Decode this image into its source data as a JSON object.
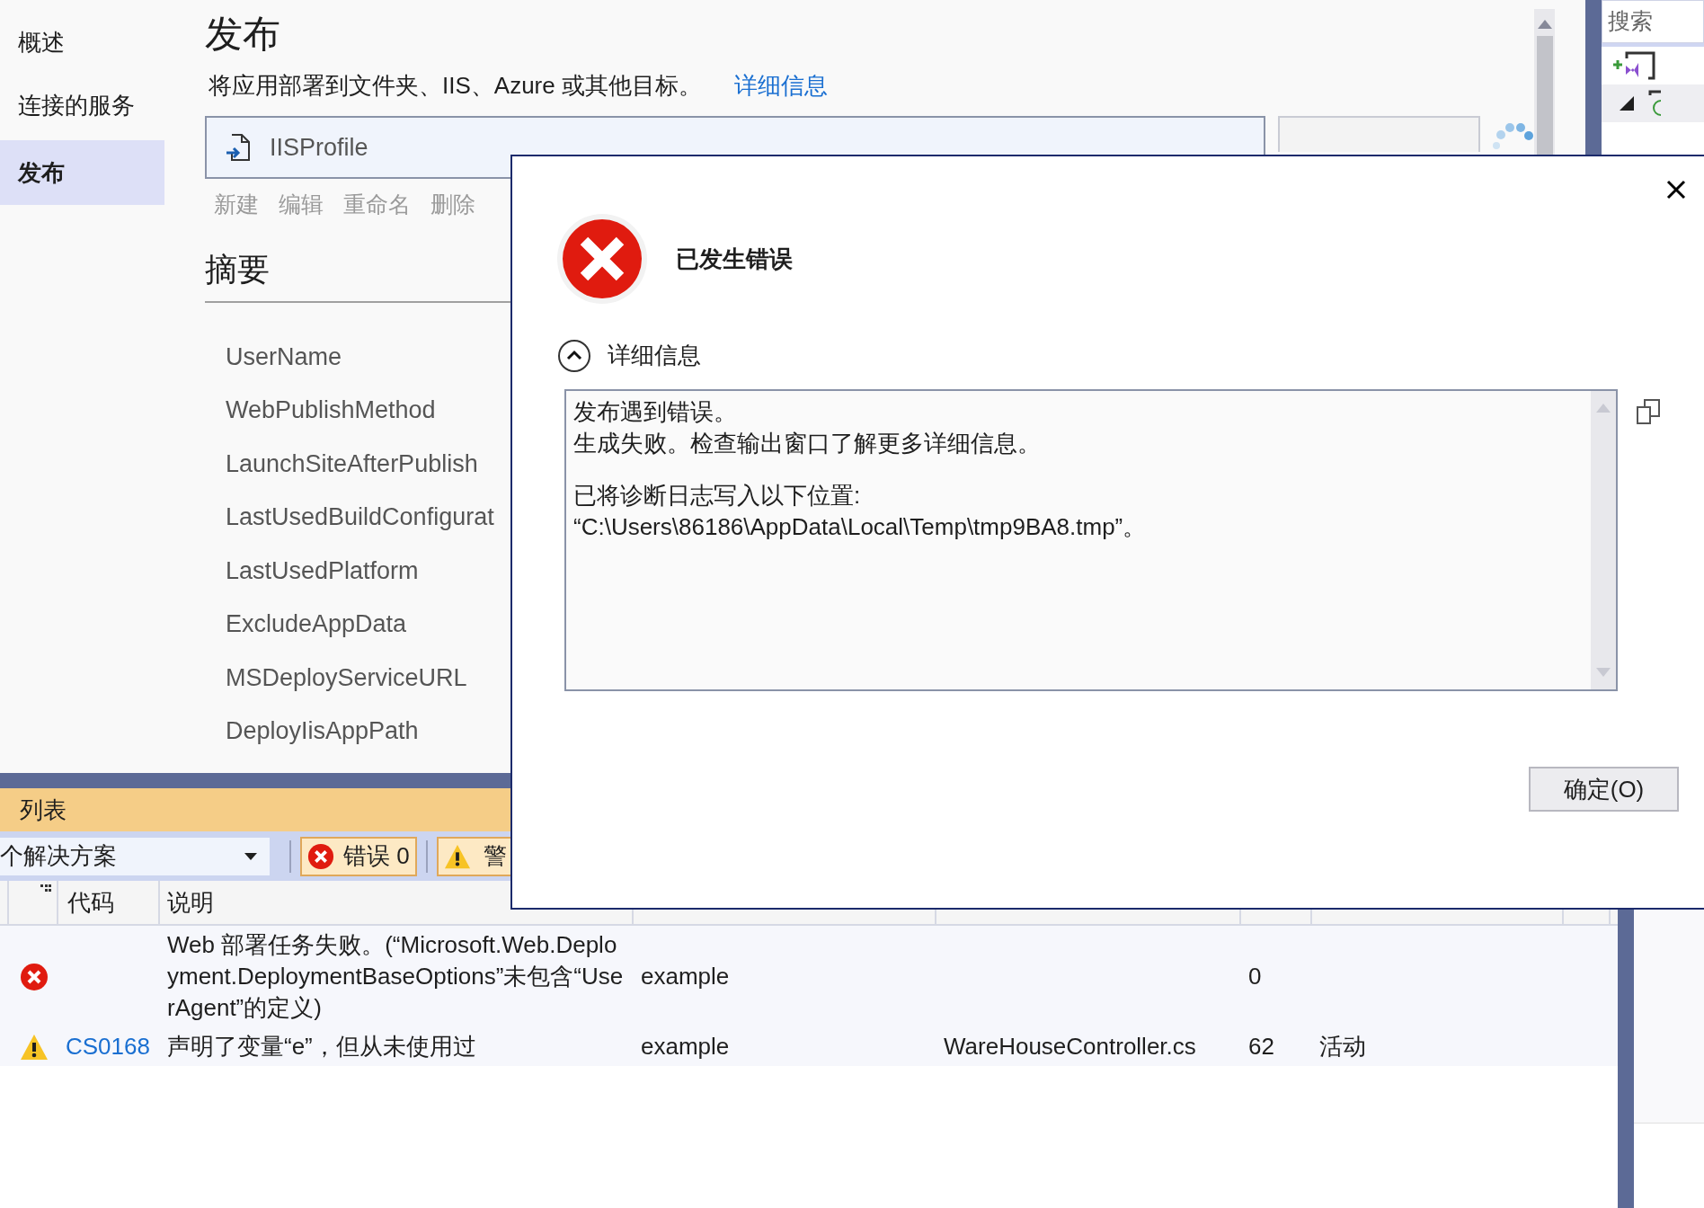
{
  "nav": {
    "items": [
      {
        "label": "概述",
        "selected": false
      },
      {
        "label": "连接的服务",
        "selected": false
      },
      {
        "label": "发布",
        "selected": true
      }
    ]
  },
  "publish": {
    "title": "发布",
    "description": "将应用部署到文件夹、IIS、Azure 或其他目标。",
    "details_link": "详细信息",
    "profile": {
      "name": "IISProfile"
    },
    "profile_actions": [
      "新建",
      "编辑",
      "重命名",
      "删除"
    ],
    "summary_title": "摘要",
    "properties": [
      "UserName",
      "WebPublishMethod",
      "LaunchSiteAfterPublish",
      "LastUsedBuildConfigurat",
      "LastUsedPlatform",
      "ExcludeAppData",
      "MSDeployServiceURL",
      "DeployIisAppPath"
    ]
  },
  "solution_explorer": {
    "search_text": "搜索"
  },
  "error_list": {
    "title": "列表",
    "scope": "个解决方案",
    "errors_filter": "错误 0",
    "warnings_filter": "警",
    "columns": [
      "代码",
      "说明"
    ],
    "rows": [
      {
        "kind": "error",
        "description": "Web 部署任务失败。(“Microsoft.Web.Deployment.DeploymentBaseOptions”未包含“UserAgent”的定义)",
        "project": "example",
        "line": "0"
      },
      {
        "kind": "warning",
        "code": "CS0168",
        "description": "声明了变量“e”，但从未使用过",
        "project": "example",
        "file": "WareHouseController.cs",
        "line": "62",
        "suppression": "活动"
      }
    ]
  },
  "dialog": {
    "title": "已发生错误",
    "details_label": "详细信息",
    "expanded": true,
    "message_paragraphs": [
      [
        "发布遇到错误。",
        "生成失败。检查输出窗口了解更多详细信息。"
      ],
      [
        "已将诊断日志写入以下位置:",
        "“C:\\Users\\86186\\AppData\\Local\\Temp\\tmp9BA8.tmp”。"
      ]
    ],
    "ok_button": "确定(O)"
  }
}
